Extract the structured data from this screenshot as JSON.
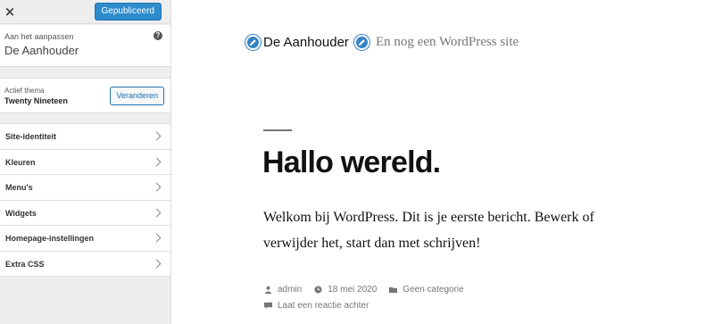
{
  "customizer": {
    "close_label": "×",
    "publish_label": "Gepubliceerd",
    "customizing_label": "Aan het aanpassen",
    "site_title": "De Aanhouder",
    "help_label": "?",
    "active_theme_label": "Actief thema",
    "theme_name": "Twenty Nineteen",
    "change_label": "Veranderen",
    "sections": [
      {
        "label": "Site-identiteit"
      },
      {
        "label": "Kleuren"
      },
      {
        "label": "Menu's"
      },
      {
        "label": "Widgets"
      },
      {
        "label": "Homepage-instellingen"
      },
      {
        "label": "Extra CSS"
      }
    ]
  },
  "preview": {
    "site_name": "De Aanhouder",
    "site_description": "En nog een WordPress site",
    "post_title": "Hallo wereld.",
    "post_body": "Welkom bij WordPress. Dit is je eerste bericht. Bewerk of verwijder het, start dan met schrijven!",
    "meta": {
      "author": "admin",
      "date": "18 mei 2020",
      "category": "Geen categorie",
      "comment": "Laat een reactie achter"
    }
  },
  "colors": {
    "accent": "#2271b1",
    "publish_bg": "#2e8ccc",
    "edit_shortcut": "#3582c4"
  }
}
